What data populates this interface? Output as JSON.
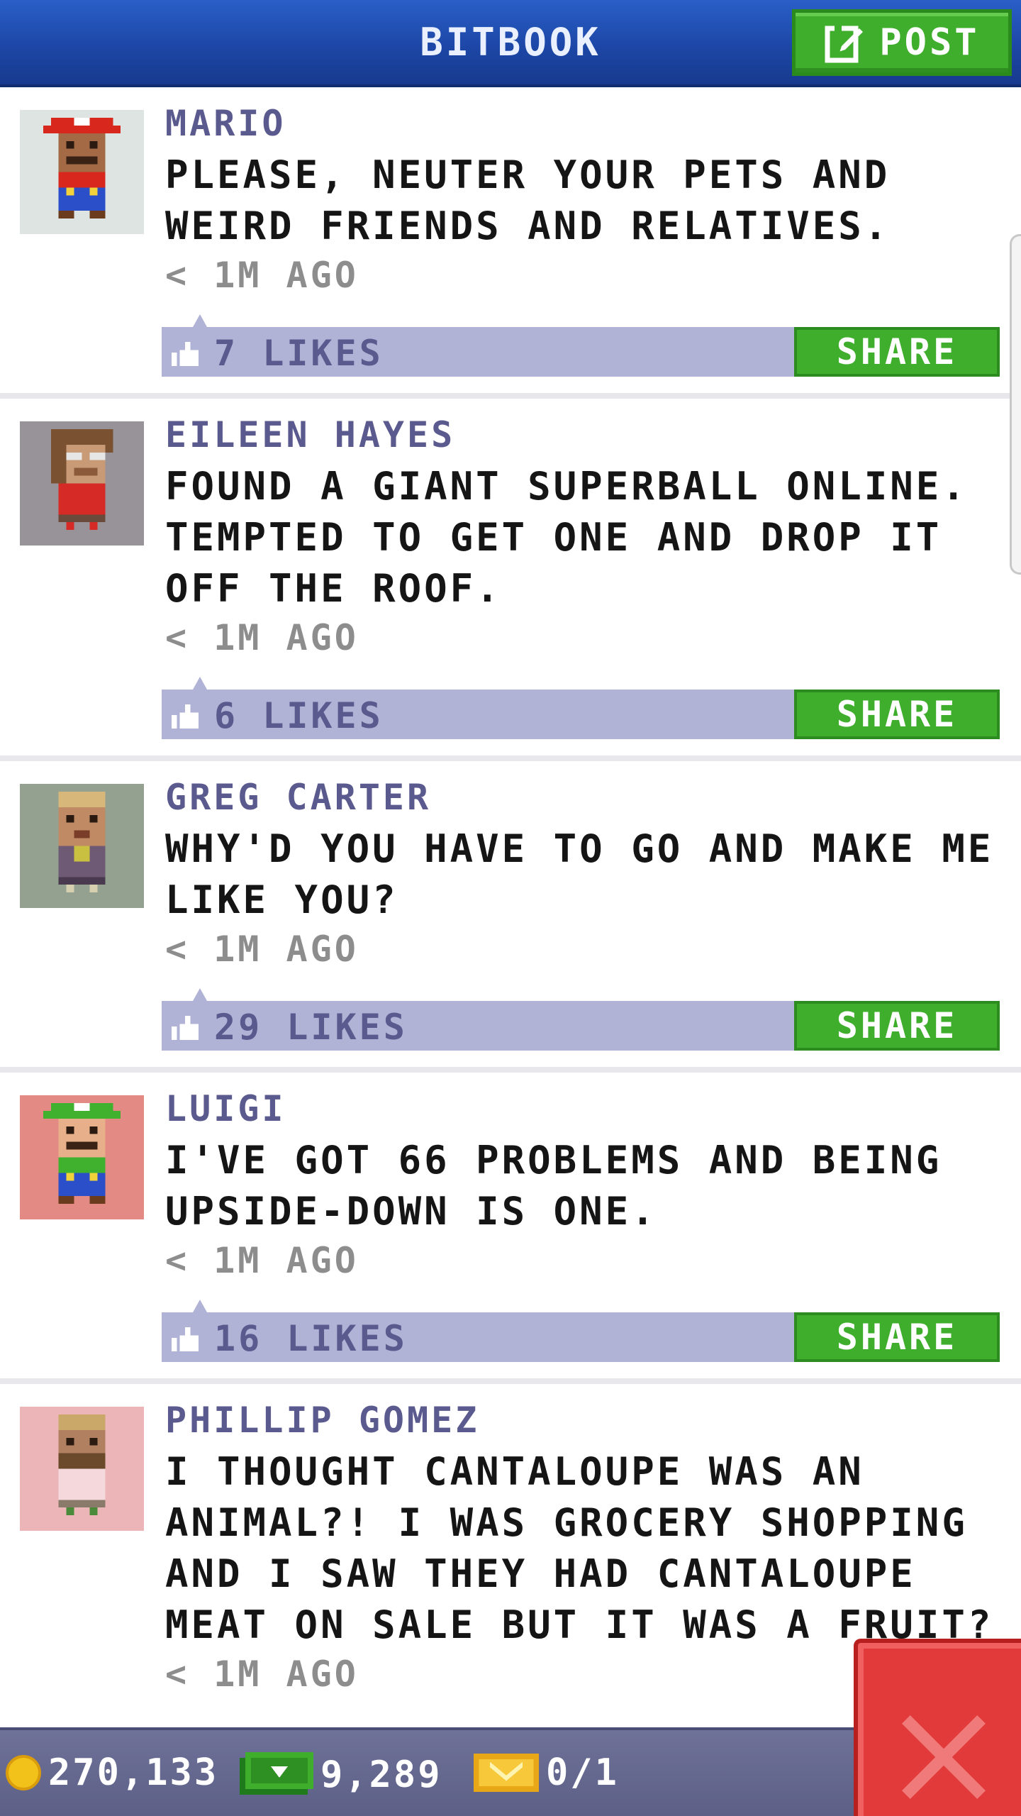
{
  "header": {
    "title": "BITBOOK",
    "post_label": "POST"
  },
  "posts": [
    {
      "author": "MARIO",
      "message": "PLEASE, NEUTER YOUR PETS AND WEIRD FRIENDS AND RELATIVES.",
      "time": "< 1M AGO",
      "likes": "7 LIKES",
      "share_label": "SHARE",
      "avatar_bg": "#dde4e2"
    },
    {
      "author": "EILEEN HAYES",
      "message": "FOUND A GIANT SUPERBALL ONLINE. TEMPTED TO GET ONE AND DROP IT OFF THE ROOF.",
      "time": "< 1M AGO",
      "likes": "6 LIKES",
      "share_label": "SHARE",
      "avatar_bg": "#989399"
    },
    {
      "author": "GREG CARTER",
      "message": "WHY'D YOU HAVE TO GO AND MAKE ME LIKE YOU?",
      "time": "< 1M AGO",
      "likes": "29 LIKES",
      "share_label": "SHARE",
      "avatar_bg": "#94a190"
    },
    {
      "author": "LUIGI",
      "message": "I'VE GOT 66 PROBLEMS AND BEING UPSIDE-DOWN IS ONE.",
      "time": "< 1M AGO",
      "likes": "16 LIKES",
      "share_label": "SHARE",
      "avatar_bg": "#e38a84"
    },
    {
      "author": "PHILLIP GOMEZ",
      "message": "I THOUGHT CANTALOUPE WAS AN ANIMAL?! I WAS GROCERY SHOPPING AND I SAW THEY HAD CANTALOUPE MEAT ON SALE BUT IT WAS A FRUIT?",
      "time": "< 1M AGO",
      "avatar_bg": "#ecb5b7"
    }
  ],
  "status": {
    "coins": "270,133",
    "bux": "9,289",
    "tickets": "0/1"
  },
  "colors": {
    "header_blue": "#1d47a7",
    "button_green": "#3fae2c",
    "likes_bar": "#b1b3d6",
    "author_text": "#5b5a8e",
    "close_red": "#e23a3a"
  },
  "icons": [
    "edit-icon",
    "like-icon",
    "coin-icon",
    "bux-icon",
    "ticket-icon",
    "close-icon"
  ]
}
